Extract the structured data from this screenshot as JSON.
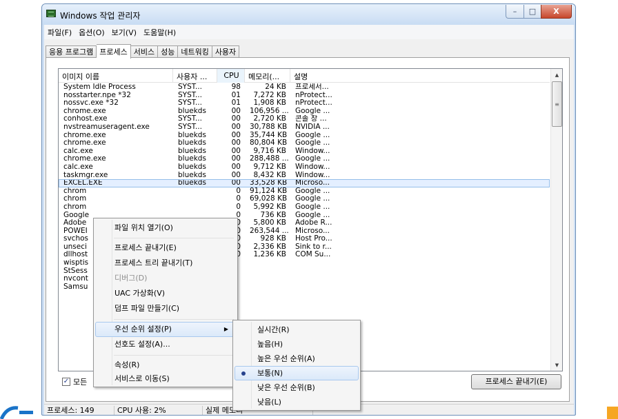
{
  "window": {
    "title": "Windows 작업 관리자",
    "controls": {
      "minimize": "–",
      "maximize": "□",
      "close": "X"
    }
  },
  "menubar": [
    "파일(F)",
    "옵션(O)",
    "보기(V)",
    "도움말(H)"
  ],
  "tabs": [
    {
      "label": "응용 프로그램",
      "active": false
    },
    {
      "label": "프로세스",
      "active": true
    },
    {
      "label": "서비스",
      "active": false
    },
    {
      "label": "성능",
      "active": false
    },
    {
      "label": "네트워킹",
      "active": false
    },
    {
      "label": "사용자",
      "active": false
    }
  ],
  "columns": {
    "name": "이미지 이름",
    "user": "사용자 ...",
    "cpu": "CPU",
    "memory": "메모리(...",
    "description": "설명",
    "sort_indicator": "^"
  },
  "processes": [
    {
      "name": "System Idle Process",
      "user": "SYST...",
      "cpu": "98",
      "mem": "24 KB",
      "desc": "프로세서..."
    },
    {
      "name": "nosstarter.npe *32",
      "user": "SYST...",
      "cpu": "01",
      "mem": "7,272 KB",
      "desc": "nProtect..."
    },
    {
      "name": "nossvc.exe *32",
      "user": "SYST...",
      "cpu": "01",
      "mem": "1,908 KB",
      "desc": "nProtect..."
    },
    {
      "name": "chrome.exe",
      "user": "bluekds",
      "cpu": "00",
      "mem": "106,956 ...",
      "desc": "Google ..."
    },
    {
      "name": "conhost.exe",
      "user": "SYST...",
      "cpu": "00",
      "mem": "2,720 KB",
      "desc": "콘솔 창 ..."
    },
    {
      "name": "nvstreamuseragent.exe",
      "user": "SYST...",
      "cpu": "00",
      "mem": "30,788 KB",
      "desc": "NVIDIA ..."
    },
    {
      "name": "chrome.exe",
      "user": "bluekds",
      "cpu": "00",
      "mem": "35,744 KB",
      "desc": "Google ..."
    },
    {
      "name": "chrome.exe",
      "user": "bluekds",
      "cpu": "00",
      "mem": "80,804 KB",
      "desc": "Google ..."
    },
    {
      "name": "calc.exe",
      "user": "bluekds",
      "cpu": "00",
      "mem": "9,716 KB",
      "desc": "Window..."
    },
    {
      "name": "chrome.exe",
      "user": "bluekds",
      "cpu": "00",
      "mem": "288,488 ...",
      "desc": "Google ..."
    },
    {
      "name": "calc.exe",
      "user": "bluekds",
      "cpu": "00",
      "mem": "9,712 KB",
      "desc": "Window..."
    },
    {
      "name": "taskmgr.exe",
      "user": "bluekds",
      "cpu": "00",
      "mem": "8,432 KB",
      "desc": "Window..."
    },
    {
      "name": "EXCEL.EXE",
      "user": "bluekds",
      "cpu": "00",
      "mem": "33,528 KB",
      "desc": "Microso...",
      "selected": true
    },
    {
      "name": "chrom",
      "user": "",
      "cpu": "0",
      "mem": "91,124 KB",
      "desc": "Google ..."
    },
    {
      "name": "chrom",
      "user": "",
      "cpu": "0",
      "mem": "69,028 KB",
      "desc": "Google ..."
    },
    {
      "name": "chrom",
      "user": "",
      "cpu": "0",
      "mem": "5,992 KB",
      "desc": "Google ..."
    },
    {
      "name": "Google",
      "user": "",
      "cpu": "0",
      "mem": "736 KB",
      "desc": "Google ..."
    },
    {
      "name": "Adobe",
      "user": "",
      "cpu": "0",
      "mem": "5,800 KB",
      "desc": "Adobe R..."
    },
    {
      "name": "POWEI",
      "user": "",
      "cpu": "0",
      "mem": "263,544 ...",
      "desc": "Microso..."
    },
    {
      "name": "svchos",
      "user": "",
      "cpu": "0",
      "mem": "928 KB",
      "desc": "Host Pro..."
    },
    {
      "name": "unseci",
      "user": "",
      "cpu": "0",
      "mem": "2,336 KB",
      "desc": "Sink to r..."
    },
    {
      "name": "dllhost",
      "user": "",
      "cpu": "0",
      "mem": "1,236 KB",
      "desc": "COM Su..."
    },
    {
      "name": "wisptis",
      "user": "",
      "cpu": "",
      "mem": "",
      "desc": ""
    },
    {
      "name": "StSess",
      "user": "",
      "cpu": "",
      "mem": "",
      "desc": ""
    },
    {
      "name": "nvcont",
      "user": "",
      "cpu": "",
      "mem": "",
      "desc": ""
    },
    {
      "name": "Samsu",
      "user": "",
      "cpu": "",
      "mem": "",
      "desc": ""
    }
  ],
  "show_all_label": "모든",
  "show_all_checked": true,
  "end_process_button": "프로세스 끝내기(E)",
  "statusbar": {
    "processes": "프로세스: 149",
    "cpu": "CPU 사용: 2%",
    "memory": "실제 메모리"
  },
  "context_menu": {
    "open_location": "파일 위치 열기(O)",
    "end_process": "프로세스 끝내기(E)",
    "end_tree": "프로세스 트리 끝내기(T)",
    "debug": "디버그(D)",
    "uac_virtualization": "UAC 가상화(V)",
    "create_dump": "덤프 파일 만들기(C)",
    "set_priority": "우선 순위 설정(P)",
    "set_affinity": "선호도 설정(A)...",
    "properties": "속성(R)",
    "go_to_service": "서비스로 이동(S)",
    "submenu_arrow": "▶"
  },
  "priority_submenu": [
    {
      "label": "실시간(R)",
      "checked": false
    },
    {
      "label": "높음(H)",
      "checked": false
    },
    {
      "label": "높은 우선 순위(A)",
      "checked": false
    },
    {
      "label": "보통(N)",
      "checked": true
    },
    {
      "label": "낮은 우선 순위(B)",
      "checked": false
    },
    {
      "label": "낮음(L)",
      "checked": false
    }
  ]
}
